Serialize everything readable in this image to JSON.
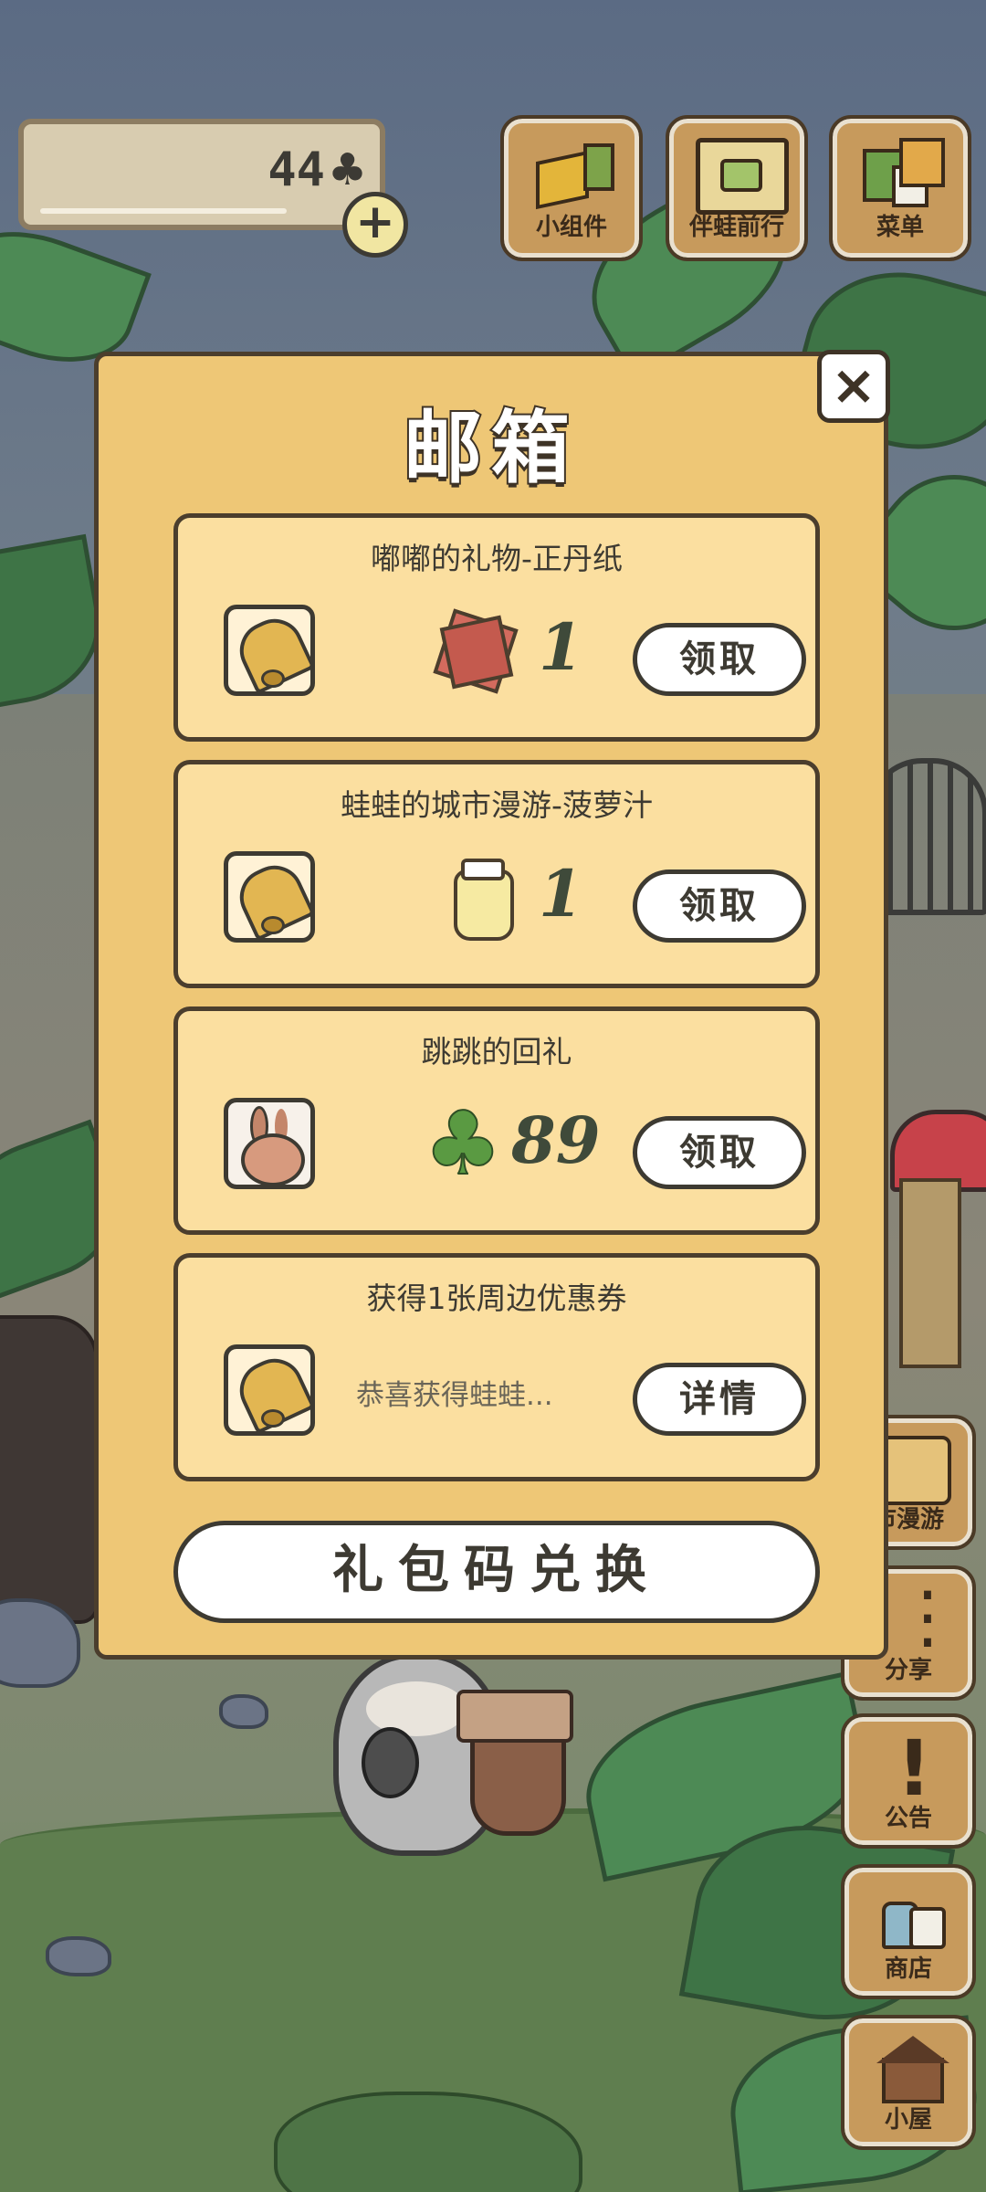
{
  "hud": {
    "currency_value": "44",
    "currency_icon": "clover-icon",
    "buttons": [
      {
        "label": "小组件",
        "icon": "widget-icon"
      },
      {
        "label": "伴蛙前行",
        "icon": "frog-book-icon"
      },
      {
        "label": "菜单",
        "icon": "menu-icon"
      }
    ]
  },
  "side": {
    "buttons": [
      {
        "label": "市漫游",
        "icon": "city-trip-icon"
      },
      {
        "label": "分享",
        "icon": "share-icon"
      },
      {
        "label": "公告",
        "icon": "notice-icon"
      },
      {
        "label": "商店",
        "icon": "shop-icon"
      },
      {
        "label": "小屋",
        "icon": "house-icon"
      }
    ]
  },
  "mailbox": {
    "title": "邮箱",
    "close_icon": "×",
    "items": [
      {
        "title": "嘟嘟的礼物-正丹纸",
        "icon": "bell-icon",
        "reward_icon": "paper-icon",
        "amount": "1",
        "button": "领取"
      },
      {
        "title": "蛙蛙的城市漫游-菠萝汁",
        "icon": "bell-icon",
        "reward_icon": "jar-icon",
        "amount": "1",
        "button": "领取"
      },
      {
        "title": "跳跳的回礼",
        "icon": "rabbit-icon",
        "reward_icon": "clover-icon",
        "amount": "89",
        "button": "领取"
      },
      {
        "title": "获得1张周边优惠券",
        "icon": "bell-icon",
        "preview": "恭喜获得蛙蛙...",
        "button": "详情"
      }
    ],
    "redeem_button": "礼包码兑换"
  },
  "colors": {
    "modal_bg": "#eec776",
    "item_bg": "#fbdfa0",
    "outline": "#3d3a32"
  }
}
